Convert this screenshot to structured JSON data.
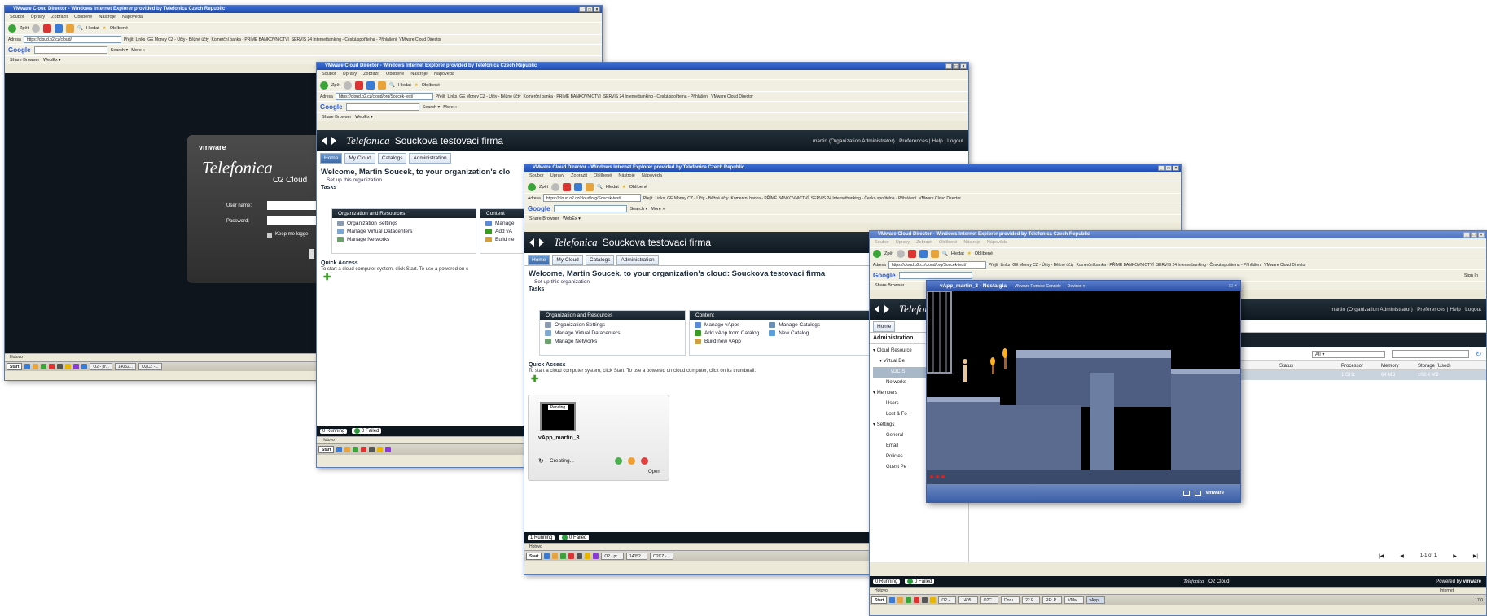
{
  "ie": {
    "title": "VMware Cloud Director - Windows Internet Explorer provided by Telefonica Czech Republic",
    "menu": [
      "Soubor",
      "Úpravy",
      "Zobrazit",
      "Oblíbené",
      "Nástroje",
      "Nápověda"
    ],
    "back_label": "Zpět",
    "search_label": "Hledat",
    "favorites_label": "Oblíbené",
    "address_label": "Adresa",
    "go_label": "Přejít",
    "links": [
      "Links",
      "GE Money CZ - Účty - Běžné účty",
      "Komerční banka - PŘÍMÉ BANKOVNICTVÍ",
      "SERVIS 24 Internetbanking - Česká spořitelna - Přihlášení",
      "VMware Cloud Director"
    ],
    "google_label": "Google",
    "google_search": "Search ▾",
    "more_label": "More »",
    "signin_label": "Sign In",
    "share_label": "Share Browser",
    "webex_label": "WebEx ▾",
    "status_text": "Hotovo",
    "internet_label": "Internet"
  },
  "w1": {
    "url": "https://cloud.o2.cz/cloud/",
    "brand": "vmware",
    "logo": "Telefonica",
    "product": "O2 Cloud",
    "username_label": "User name:",
    "password_label": "Password:",
    "keep_label": "Keep me logge"
  },
  "w2": {
    "url": "https://cloud.o2.cz/cloud/org/Soucek-test/"
  },
  "w3": {
    "url": "https://cloud.o2.cz/cloud/org/Soucek-test/"
  },
  "vcd": {
    "org": "Souckova testovaci firma",
    "user": "martin",
    "role": "(Organization Administrator)",
    "preferences": "Preferences",
    "help": "Help",
    "logout": "Logout",
    "tabs": [
      "Home",
      "My Cloud",
      "Catalogs",
      "Administration"
    ],
    "welcome": "Welcome, Martin Soucek, to your organization's cloud: Souckova testovaci firma",
    "welcome_short": "Welcome, Martin Soucek, to your organization's clo",
    "setup": "Set up this organization",
    "tasks": "Tasks",
    "org_panel": "Organization and Resources",
    "org_items": [
      "Organization Settings",
      "Manage Virtual Datacenters",
      "Manage Networks"
    ],
    "content_panel": "Content",
    "content_items": [
      "Manage vApps",
      "Add vApp from Catalog",
      "Build new vApp"
    ],
    "content_items_short": [
      "Manage",
      "Add vA",
      "Build ne"
    ],
    "content_items2": [
      "Manage Catalogs",
      "New Catalog"
    ],
    "quick_access": "Quick Access",
    "quick_text": "To start a cloud computer system, click Start. To use a powered on cloud computer, click on its thumbnail.",
    "quick_text_short": "To start a cloud computer system, click Start. To use a powered on c",
    "vapp_status": "Pending",
    "vapp_name": "vApp_martin_3",
    "vapp_state": "Creating...",
    "vapp_open": "Open",
    "footer_running": "0 Running",
    "footer_failed": "0 Failed",
    "footer_running3": "1 Running",
    "footer_failed3": "0 Failed",
    "footer_brand": "Telefonica",
    "footer_cloud": "O2 Cloud",
    "powered": "Powered by",
    "powered_brand": "vmware"
  },
  "w4": {
    "admin_title": "Administration",
    "tree": [
      "Cloud Resource",
      "Virtual De",
      "vDC S",
      "Networks",
      "Members",
      "Users",
      "Lost & Fo",
      "Settings",
      "General",
      "Email",
      "Policies",
      "Guest Pe"
    ],
    "filter": "All",
    "columns": [
      "Status",
      "Processor",
      "Memory",
      "Storage (Used)"
    ],
    "row": [
      "ning",
      "1 GHz",
      "64 MB",
      "102.4 MB"
    ],
    "pager": "1-1 of 1"
  },
  "console": {
    "title": "vApp_martin_3 - Nostalgia",
    "menu": [
      "VMware Remote Console",
      "Devices ▾"
    ],
    "footer_brand": "vmware"
  },
  "taskbar": {
    "start": "Start",
    "buttons1": [
      "O2 - pr...",
      "14052...",
      "O2CZ -..."
    ],
    "buttons4": [
      "O2 -...",
      "1405...",
      "O2C...",
      "Doru...",
      "22 P...",
      "RE: P...",
      "VMw...",
      "vApp..."
    ],
    "clock": "17:0"
  },
  "colors": {
    "titlebar": "#2a5dc8",
    "vcd_head": "#17222b",
    "login_bg": "#0e141c"
  }
}
